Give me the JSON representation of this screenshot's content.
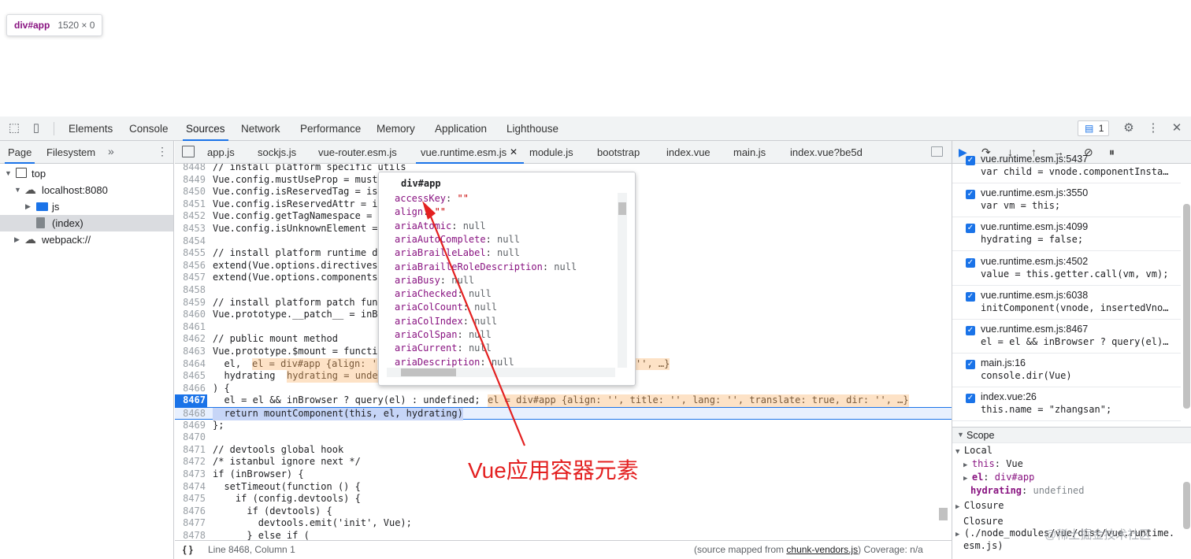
{
  "tooltip": {
    "tag": "div#app",
    "size": "1520 × 0"
  },
  "toolbar": {
    "tabs": [
      "Elements",
      "Console",
      "Sources",
      "Network",
      "Performance",
      "Memory",
      "Application",
      "Lighthouse"
    ],
    "active": "Sources",
    "msg_count": "1"
  },
  "navigator": {
    "tabs": [
      "Page",
      "Filesystem"
    ],
    "tree": [
      "top",
      "localhost:8080",
      "js",
      "(index)",
      "webpack://"
    ]
  },
  "file_tabs": [
    "app.js",
    "sockjs.js",
    "vue-router.esm.js",
    "vue.runtime.esm.js",
    "module.js",
    "bootstrap",
    "index.vue",
    "main.js",
    "index.vue?be5d"
  ],
  "active_file": "vue.runtime.esm.js",
  "code": {
    "lines": [
      {
        "n": "8448",
        "t": "// install platform specific utils",
        "c": "cm"
      },
      {
        "n": "8449",
        "t": "Vue.config.mustUseProp = mustU"
      },
      {
        "n": "8450",
        "t": "Vue.config.isReservedTag = isR"
      },
      {
        "n": "8451",
        "t": "Vue.config.isReservedAttr = is"
      },
      {
        "n": "8452",
        "t": "Vue.config.getTagNamespace = g"
      },
      {
        "n": "8453",
        "t": "Vue.config.isUnknownElement = "
      },
      {
        "n": "8454",
        "t": ""
      },
      {
        "n": "8455",
        "t": "// install platform runtime di",
        "c": "cm"
      },
      {
        "n": "8456",
        "t": "extend(Vue.options.directives,"
      },
      {
        "n": "8457",
        "t": "extend(Vue.options.components,"
      },
      {
        "n": "8458",
        "t": ""
      },
      {
        "n": "8459",
        "t": "// install platform patch func",
        "c": "cm"
      },
      {
        "n": "8460",
        "t": "Vue.prototype.__patch__ = inBr"
      },
      {
        "n": "8461",
        "t": ""
      },
      {
        "n": "8462",
        "t": "// public mount method",
        "c": "cm"
      },
      {
        "n": "8463",
        "t": "Vue.prototype.$mount = functio"
      },
      {
        "n": "8464",
        "t": "  el,"
      },
      {
        "n": "8465",
        "t": "  hydrating"
      },
      {
        "n": "8466",
        "t": ") {"
      },
      {
        "n": "8467",
        "t": "  el = el && inBrowser ? query(el) : undefined;"
      },
      {
        "n": "8468",
        "t": "  return mountComponent(this, el, hydrating)"
      },
      {
        "n": "8469",
        "t": "};"
      },
      {
        "n": "8470",
        "t": ""
      },
      {
        "n": "8471",
        "t": "// devtools global hook",
        "c": "cm"
      },
      {
        "n": "8472",
        "t": "/* istanbul ignore next */",
        "c": "cm"
      },
      {
        "n": "8473",
        "t": "if (inBrowser) {"
      },
      {
        "n": "8474",
        "t": "  setTimeout(function () {"
      },
      {
        "n": "8475",
        "t": "    if (config.devtools) {"
      },
      {
        "n": "8476",
        "t": "      if (devtools) {"
      },
      {
        "n": "8477",
        "t": "        devtools.emit('init', Vue);"
      },
      {
        "n": "8478",
        "t": "      } else if ("
      }
    ],
    "inline_8464": "el = div#app {align: '",
    "inline_8464_tail": "'', …}",
    "inline_8465": "hydrating = unde",
    "inline_8467": "el = div#app {align: '', title: '', lang: '', translate: true, dir: '', …}"
  },
  "popup": {
    "title": "div#app",
    "props": [
      {
        "k": "accessKey",
        "v": "\"\"",
        "s": true
      },
      {
        "k": "align",
        "v": "\"\"",
        "s": true
      },
      {
        "k": "ariaAtomic",
        "v": "null"
      },
      {
        "k": "ariaAutoComplete",
        "v": "null"
      },
      {
        "k": "ariaBrailleLabel",
        "v": "null"
      },
      {
        "k": "ariaBrailleRoleDescription",
        "v": "null"
      },
      {
        "k": "ariaBusy",
        "v": "null"
      },
      {
        "k": "ariaChecked",
        "v": "null"
      },
      {
        "k": "ariaColCount",
        "v": "null"
      },
      {
        "k": "ariaColIndex",
        "v": "null"
      },
      {
        "k": "ariaColSpan",
        "v": "null"
      },
      {
        "k": "ariaCurrent",
        "v": "null"
      },
      {
        "k": "ariaDescription",
        "v": "null"
      }
    ]
  },
  "status": {
    "position": "Line 8468, Column 1",
    "source_prefix": "(source mapped from ",
    "source_link": "chunk-vendors.js",
    "source_suffix": ")",
    "coverage": "Coverage: n/a"
  },
  "callstack": [
    {
      "file": "vue.runtime.esm.js:5437",
      "code": "var child = vnode.componentInsta…"
    },
    {
      "file": "vue.runtime.esm.js:3550",
      "code": "var vm = this;"
    },
    {
      "file": "vue.runtime.esm.js:4099",
      "code": "hydrating = false;"
    },
    {
      "file": "vue.runtime.esm.js:4502",
      "code": "value = this.getter.call(vm, vm);"
    },
    {
      "file": "vue.runtime.esm.js:6038",
      "code": "initComponent(vnode, insertedVno…"
    },
    {
      "file": "vue.runtime.esm.js:8467",
      "code": "el = el && inBrowser ? query(el)…"
    },
    {
      "file": "main.js:16",
      "code": "console.dir(Vue)"
    },
    {
      "file": "index.vue:26",
      "code": "this.name = \"zhangsan\";"
    }
  ],
  "scope": {
    "header": "Scope",
    "local": "Local",
    "this_key": "this",
    "this_val": "Vue",
    "el_key": "el",
    "el_val": "div#app",
    "hyd_key": "hydrating",
    "hyd_val": "undefined",
    "closure": "Closure",
    "closure2": "Closure",
    "closure2_path": "(./node_modules/vue/dist/vue.runtime.",
    "closure2_path2": "esm.js)"
  },
  "annotation": "Vue应用容器元素",
  "watermark": "@稀土掘金技术社区",
  "colors": {
    "accent": "#1a73e8",
    "annotation": "#e32020",
    "breakpoint": "#1a73e8"
  }
}
